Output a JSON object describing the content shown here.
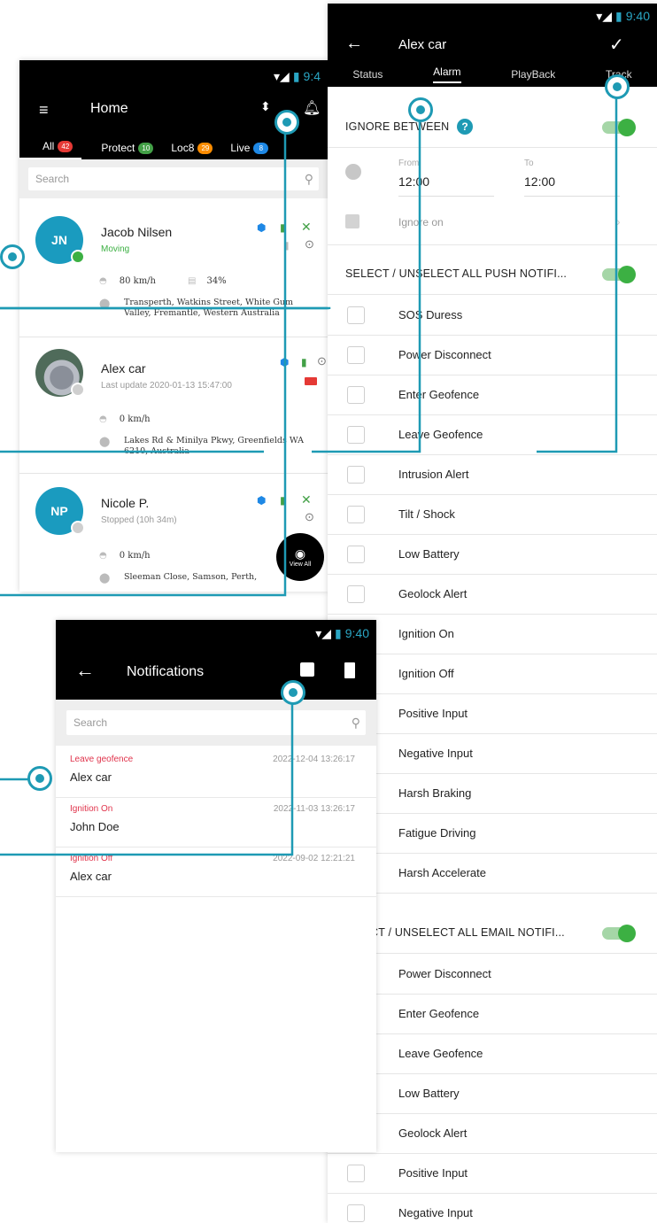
{
  "home": {
    "status_time": "9:4",
    "title": "Home",
    "tabs": [
      {
        "label": "All",
        "count": "42",
        "color": "#e53935"
      },
      {
        "label": "Protect",
        "count": "10",
        "color": "#43a047"
      },
      {
        "label": "Loc8",
        "count": "29",
        "color": "#fb8c00"
      },
      {
        "label": "Live",
        "count": "8",
        "color": "#1e88e5"
      }
    ],
    "search_placeholder": "Search",
    "vehicles": [
      {
        "initials": "JN",
        "name": "Jacob Nilsen",
        "state": "Moving",
        "speed": "80 km/h",
        "fuel": "34%",
        "address": "Transperth, Watkins Street, White Gum Valley, Fremantle, Western Australia"
      },
      {
        "initials": "",
        "name": "Alex car",
        "state": "Last update 2020-01-13 15:47:00",
        "speed": "0 km/h",
        "address": "Lakes Rd & Minilya Pkwy, Greenfields WA 6210, Australia"
      },
      {
        "initials": "NP",
        "name": "Nicole P.",
        "state": "Stopped (10h 34m)",
        "speed": "0 km/h",
        "address": "Sleeman Close, Samson, Perth,"
      }
    ],
    "view_all": "View All"
  },
  "alarm": {
    "status_time": "9:40",
    "title": "Alex car",
    "tabs": [
      "Status",
      "Alarm",
      "PlayBack",
      "Track"
    ],
    "ignore_between": "IGNORE BETWEEN",
    "from_label": "From",
    "from_value": "12:00",
    "to_label": "To",
    "to_value": "12:00",
    "ignore_on": "Ignore on",
    "push_section": "SELECT / UNSELECT ALL PUSH NOTIFI...",
    "push_items": [
      "SOS Duress",
      "Power Disconnect",
      "Enter Geofence",
      "Leave Geofence",
      "Intrusion Alert",
      "Tilt / Shock",
      "Low Battery",
      "Geolock Alert",
      "Ignition On",
      "Ignition Off",
      "Positive Input",
      "Negative Input",
      "Harsh Braking",
      "Fatigue Driving",
      "Harsh Accelerate"
    ],
    "email_section": "CT / UNSELECT ALL EMAIL NOTIFI...",
    "email_items": [
      "Power Disconnect",
      "Enter Geofence",
      "Leave Geofence",
      "Low Battery",
      "Geolock Alert",
      "Positive Input",
      "Negative Input"
    ]
  },
  "notifications": {
    "status_time": "9:40",
    "title": "Notifications",
    "search_placeholder": "Search",
    "items": [
      {
        "type": "Leave geofence",
        "name": "Alex car",
        "time": "2022-12-04 13:26:17"
      },
      {
        "type": "Ignition On",
        "name": "John Doe",
        "time": "2022-11-03 13:26:17"
      },
      {
        "type": "Ignition Off",
        "name": "Alex car",
        "time": "2022-09-02 12:21:21"
      }
    ]
  },
  "colors": {
    "accent": "#1e9ab4",
    "alert": "#e0344c",
    "online": "#3cb043",
    "teal_avatar": "#1a9bbf"
  }
}
